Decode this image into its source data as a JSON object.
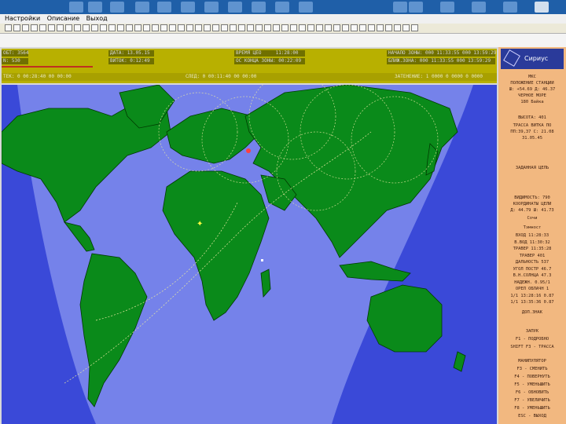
{
  "menu": {
    "items": [
      "Настройки",
      "Описание",
      "Выход"
    ]
  },
  "header": {
    "row1": [
      {
        "label": "ОБТ",
        "value": "3564"
      },
      {
        "label": "ДАТА",
        "value": "13.05.15"
      },
      {
        "label": "ВРЕМЯ ЦЕО",
        "value": "11:28:00"
      },
      {
        "label": "НАЧАЛО ЗОНЫ",
        "value": "000 11:33:55"
      },
      {
        "label": "",
        "value": "000 13:59:29"
      }
    ],
    "row2": [
      {
        "label": "N",
        "value": "530"
      },
      {
        "label": "ВИТОК",
        "value": "0:12:49"
      },
      {
        "label": "ОС КОНЦА ЗОНЫ",
        "value": "00:22:09"
      },
      {
        "label": "БЛИЖ.ЗОНА",
        "value": "000 11:33:55"
      },
      {
        "label": "",
        "value": "000 13:59:29"
      }
    ],
    "status_left": "ТЕК: 0 00:28:40 00 00:00",
    "status_center": "СЛЕД: 0 00:11:40 00 00:00",
    "status_right": "ЗАТЕНЕНИЕ: 1 0000 0 0000 0 0000"
  },
  "panel": {
    "logo_text": "Сириус",
    "station": "МКС",
    "station_sub": "ПОЛОЖЕНИЕ СТАНЦИИ",
    "coords": "Ш: +54.69  Д: 46.37",
    "over": "ЧЕРНОЕ МОРЕ",
    "over2": "180 Байка",
    "height": "ВЫСОТА: 401",
    "trace": "ТРАССА ВИТКА ПО",
    "trace_vals": "ПП:39,37 С: 21.08",
    "trace_vals2": "31.05.45",
    "target_title": "ЗАДАННАЯ ЦЕЛЬ",
    "visibility": "ВИДИМОСТЬ: 790",
    "target_coords": "КООРДИНАТЫ ЦЕЛИ",
    "target_coords_vals": "Д: 44.79 Ш: 41.73",
    "target_name": "Сочи",
    "times_title": "Тэмност",
    "rows": [
      "ВХОД      11:28:33",
      "В.ВОД     11:30:32",
      "ТРАВЕР  11:35:28",
      "ТРАВЕР   401",
      "ДАЛЬНОСТЬ  537",
      "УГОЛ ПОСТР  46.7",
      "В.Н.СОЛНЦА  47.3",
      "НАДЕЖН. 0.95/1",
      "ОРЕЛ ОБЛАЧН  1",
      "1/1  13:28:16  0.87",
      "1/1  13:35:36  0.87"
    ],
    "bottom_label": "ДОП.ЗНАК",
    "keys_title": "ЗАПУК",
    "keys_row1": "F1 - ПОДРОБНО",
    "keys_row2": "SHIFT F3 - ТРАССА",
    "manip_title": "МАНИПУЛЯТОР",
    "manip": [
      "F3 - СМЕНИТЬ",
      "F4 - ПОВЕРНУТЬ",
      "F5 - УМЕНЬШИТЬ",
      "F6 - ОБНОВИТЬ",
      "F7 - УВЕЛИЧИТЬ",
      "F8 - УМЕНЬШИТЬ",
      "ESC - ВЫХОД"
    ]
  },
  "colors": {
    "ocean": "#3a49d8",
    "land": "#0a8a1a",
    "visibility_zone": "#8a96f0",
    "info_panel": "#b8b000",
    "side_panel": "#f2b880"
  }
}
